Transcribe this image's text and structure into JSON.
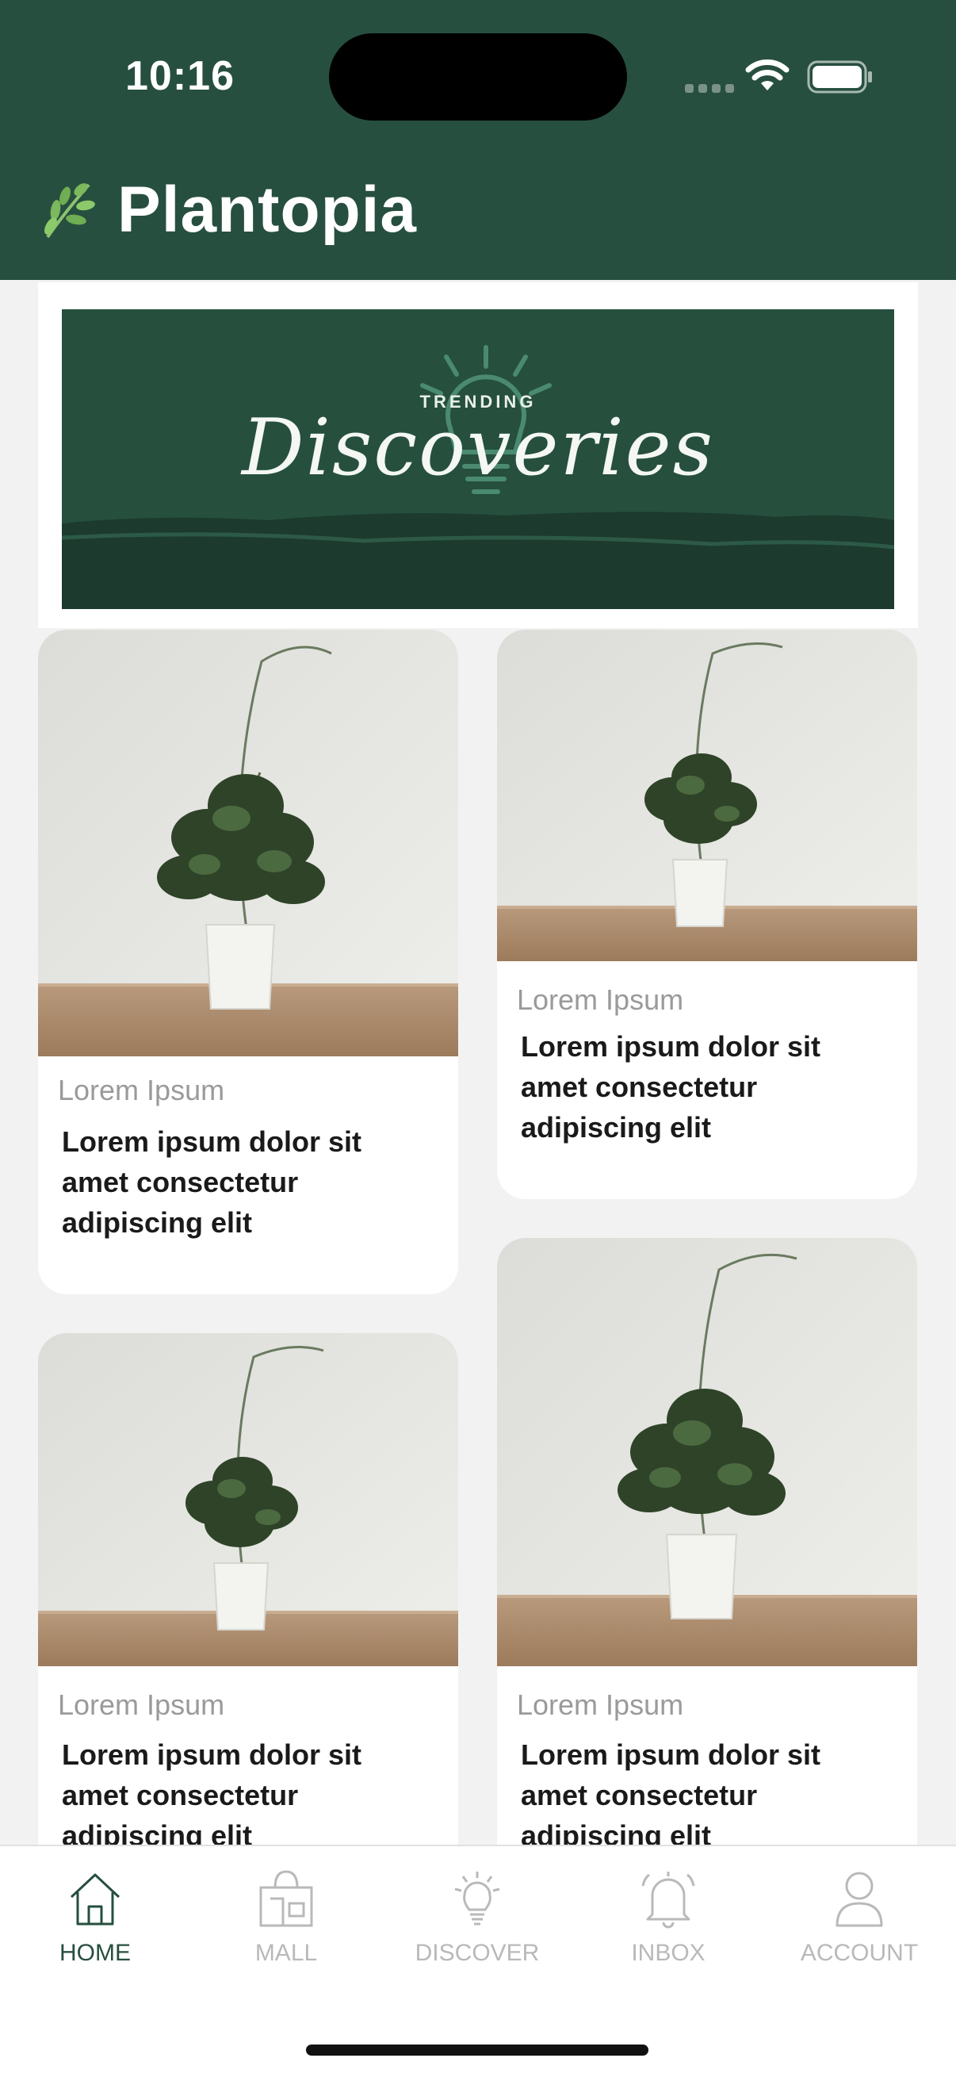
{
  "status": {
    "time": "10:16"
  },
  "app": {
    "title": "Plantopia",
    "brand_color": "#274f3f"
  },
  "banner": {
    "small": "TRENDING",
    "big": "Discoveries"
  },
  "cards": [
    {
      "subtitle": "Lorem Ipsum",
      "title": "Lorem ipsum dolor sit\namet consectetur\nadipiscing elit"
    },
    {
      "subtitle": "Lorem Ipsum",
      "title": "Lorem ipsum dolor sit\namet consectetur\nadipiscing elit"
    },
    {
      "subtitle": "Lorem Ipsum",
      "title": "Lorem ipsum dolor sit\namet consectetur\nadipiscing elit"
    },
    {
      "subtitle": "Lorem Ipsum",
      "title": "Lorem ipsum dolor sit\namet consectetur\nadipiscing elit"
    }
  ],
  "tabs": [
    {
      "label": "HOME",
      "icon": "home-icon",
      "active": true
    },
    {
      "label": "MALL",
      "icon": "store-icon",
      "active": false
    },
    {
      "label": "DISCOVER",
      "icon": "lightbulb-icon",
      "active": false
    },
    {
      "label": "INBOX",
      "icon": "bell-icon",
      "active": false
    },
    {
      "label": "ACCOUNT",
      "icon": "person-icon",
      "active": false
    }
  ]
}
